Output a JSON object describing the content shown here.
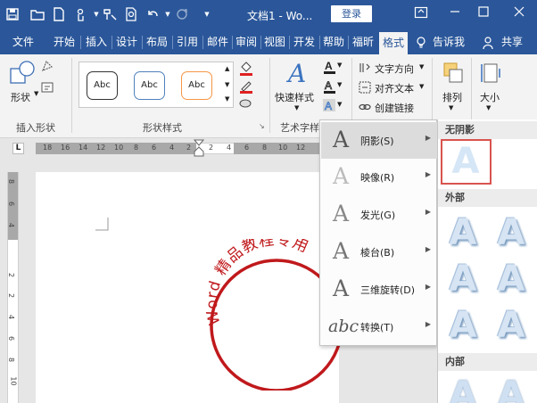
{
  "titlebar": {
    "title": "文档1 - Wo...",
    "login_label": "登录"
  },
  "tabs": [
    "文件",
    "开始",
    "插入",
    "设计",
    "布局",
    "引用",
    "邮件",
    "审阅",
    "视图",
    "开发",
    "帮助",
    "福昕",
    "格式"
  ],
  "active_tab": "格式",
  "tell_me": "告诉我",
  "share_label": "共享",
  "ribbon": {
    "shape_label": "形状",
    "insert_shape_group": "插入形状",
    "style_boxes": [
      "Abc",
      "Abc",
      "Abc"
    ],
    "shape_styles_group": "形状样式",
    "quick_styles_label": "快速样式",
    "art_group_label": "艺术字样",
    "text_direction": "文字方向",
    "align_text": "对齐文本",
    "create_link": "创建链接",
    "arrange_label": "排列",
    "size_label": "大小",
    "style_colors": [
      "#333333",
      "#4f81bd",
      "#f79646"
    ]
  },
  "ruler": {
    "marker": "L",
    "numbers": [
      "18",
      "16",
      "14",
      "12",
      "10",
      "8",
      "6",
      "4",
      "2",
      "2",
      "4",
      "6",
      "8",
      "10",
      "12",
      "14",
      "16",
      "18"
    ],
    "vertical_numbers": [
      "8",
      "6",
      "4",
      "2",
      "2",
      "4",
      "6",
      "8",
      "10"
    ]
  },
  "document": {
    "stamp_text": "Word 精品教程专用",
    "stamp_color": "#c0191c"
  },
  "menu": {
    "items": [
      {
        "label": "阴影(S)",
        "icon": "A"
      },
      {
        "label": "映像(R)",
        "icon": "A"
      },
      {
        "label": "发光(G)",
        "icon": "A"
      },
      {
        "label": "棱台(B)",
        "icon": "A"
      },
      {
        "label": "三维旋转(D)",
        "icon": "A"
      },
      {
        "label": "转换(T)",
        "icon": "abc"
      }
    ]
  },
  "submenu": {
    "no_shadow": "无阴影",
    "outer": "外部",
    "inner": "内部",
    "tile_letter": "A"
  },
  "colors": {
    "brand": "#2b579a",
    "selection": "#d9534f"
  }
}
